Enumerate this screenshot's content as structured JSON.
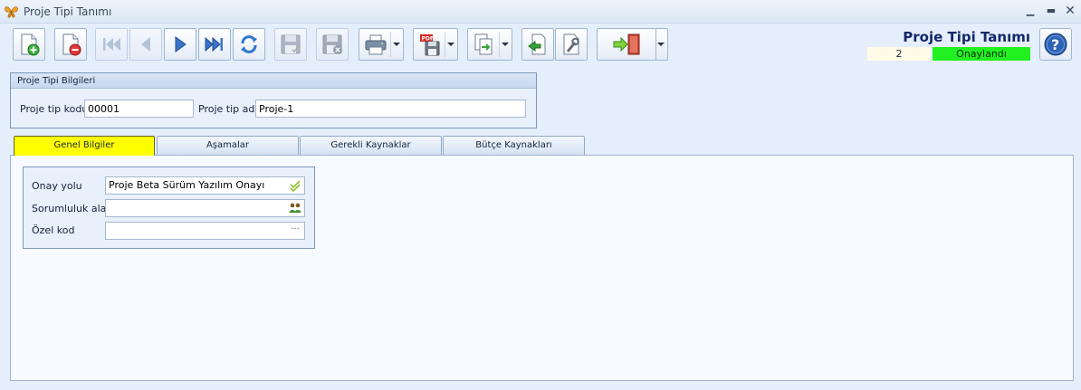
{
  "window": {
    "title": "Proje Tipi Tanımı",
    "icons": [
      "butterfly-icon",
      "minimize-icon",
      "maximize-icon",
      "close-icon"
    ]
  },
  "toolbar": {
    "buttons": [
      {
        "name": "new-record-button",
        "icon": "new-document-icon"
      },
      {
        "name": "delete-record-button",
        "icon": "delete-document-icon"
      },
      {
        "name": "first-record-button",
        "icon": "first-icon"
      },
      {
        "name": "previous-record-button",
        "icon": "previous-icon"
      },
      {
        "name": "next-record-button",
        "icon": "next-icon"
      },
      {
        "name": "last-record-button",
        "icon": "last-icon"
      },
      {
        "name": "refresh-button",
        "icon": "refresh-icon"
      },
      {
        "name": "save-button",
        "icon": "save-icon"
      },
      {
        "name": "cancel-save-button",
        "icon": "save-cancel-icon"
      },
      {
        "name": "print-button",
        "icon": "printer-icon"
      },
      {
        "name": "pdf-export-button",
        "icon": "pdf-icon"
      },
      {
        "name": "export-button",
        "icon": "export-icon"
      },
      {
        "name": "import-button",
        "icon": "import-icon"
      },
      {
        "name": "settings-button",
        "icon": "wrench-icon"
      },
      {
        "name": "exit-button",
        "icon": "exit-door-icon"
      }
    ]
  },
  "header": {
    "title": "Proje Tipi Tanımı",
    "status_number": "2",
    "status_label": "Onaylandı",
    "status_color": "#21f021"
  },
  "info_group": {
    "title": "Proje Tipi Bilgileri",
    "code_label": "Proje tip kodu",
    "code_value": "00001",
    "name_label": "Proje tip adı",
    "name_value": "Proje-1"
  },
  "tabs": [
    {
      "label": "Genel Bilgiler",
      "active": true
    },
    {
      "label": "Aşamalar",
      "active": false
    },
    {
      "label": "Gerekli Kaynaklar",
      "active": false
    },
    {
      "label": "Bütçe Kaynakları",
      "active": false
    }
  ],
  "general": {
    "approval_label": "Onay yolu",
    "approval_value": "Proje Beta Sürüm Yazılım Onayı",
    "responsibility_label": "Sorumluluk alanı",
    "responsibility_value": "",
    "special_code_label": "Özel kod",
    "special_code_value": "",
    "ellipsis": "···"
  }
}
